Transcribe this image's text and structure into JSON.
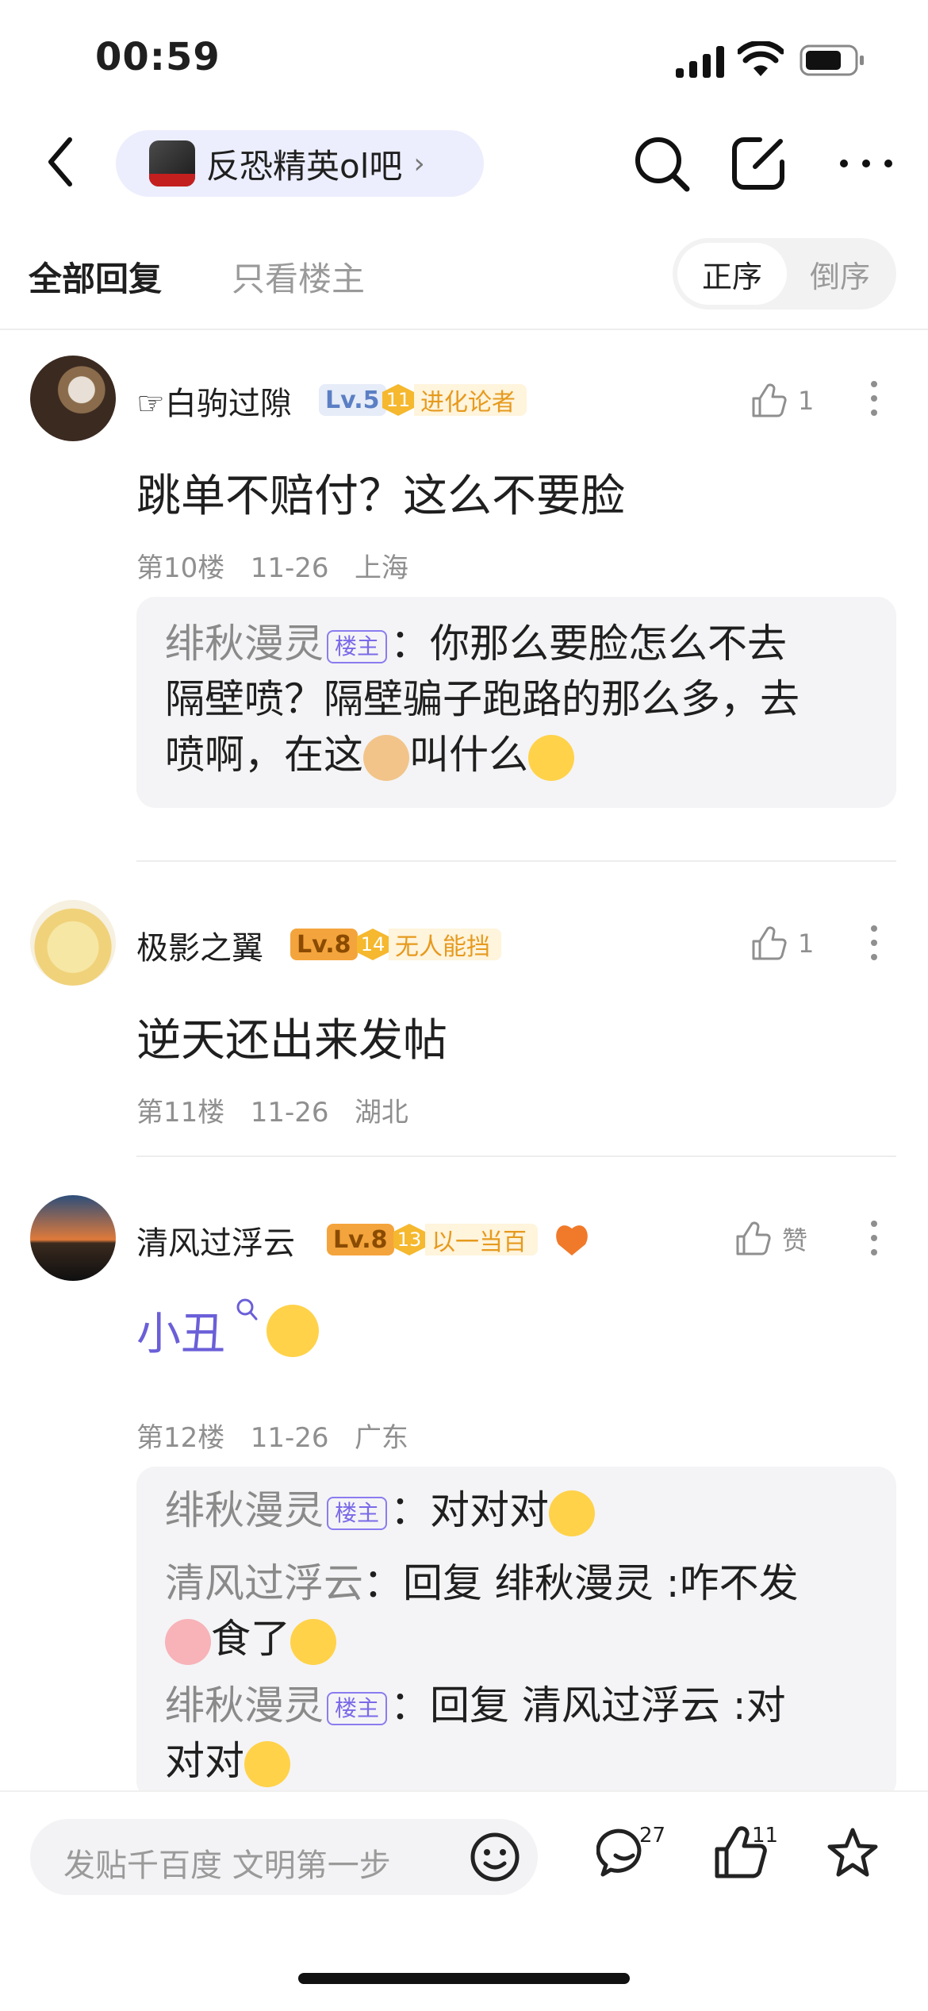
{
  "status_bar": {
    "time": "00:59"
  },
  "nav": {
    "forum_name": "反恐精英ol吧",
    "forum_chevron": "›"
  },
  "tabs": {
    "all": "全部回复",
    "op_only": "只看楼主"
  },
  "sort": {
    "asc": "正序",
    "desc": "倒序"
  },
  "posts": [
    {
      "username": "☞白驹过隙",
      "level": "Lv.5",
      "badge_num": "11",
      "badge_text": "进化论者",
      "likes": "1",
      "content": "跳单不赔付？这么不要脸",
      "floor": "第10楼",
      "date": "11-26",
      "location": "上海",
      "replies": [
        {
          "name": "绯秋漫灵",
          "tag": "楼主",
          "sep": "：",
          "text1": "你那么要脸怎么不去",
          "text2": "隔壁喷？隔壁骗子跑路的那么多，去",
          "text3a": "喷啊，在这",
          "text3b": "叫什么"
        }
      ]
    },
    {
      "username": "极影之翼",
      "level": "Lv.8",
      "badge_num": "14",
      "badge_text": "无人能挡",
      "likes": "1",
      "content": "逆天还出来发帖",
      "floor": "第11楼",
      "date": "11-26",
      "location": "湖北"
    },
    {
      "username": "清风过浮云",
      "level": "Lv.8",
      "badge_num": "13",
      "badge_text": "以一当百",
      "likes": "赞",
      "content": "小丑",
      "floor": "第12楼",
      "date": "11-26",
      "location": "广东",
      "replies": [
        {
          "name": "绯秋漫灵",
          "tag": "楼主",
          "sep": "：",
          "text1": "对对对"
        },
        {
          "name": "清风过浮云",
          "sep": "：",
          "text1": "回复 绯秋漫灵 :咋不发",
          "text2": "食了"
        },
        {
          "name": "绯秋漫灵",
          "tag": "楼主",
          "sep": "：",
          "text1": "回复 清风过浮云 :对",
          "text2": "对对"
        }
      ]
    }
  ],
  "bottom_bar": {
    "input_placeholder": "发贴千百度 文明第一步",
    "comment_count": "27",
    "like_count": "11"
  },
  "colors": {
    "accent": "#7a6ae8",
    "lv5": "#5b7fc4",
    "lv8": "#e39a2a",
    "badge": "#f5b82e"
  }
}
